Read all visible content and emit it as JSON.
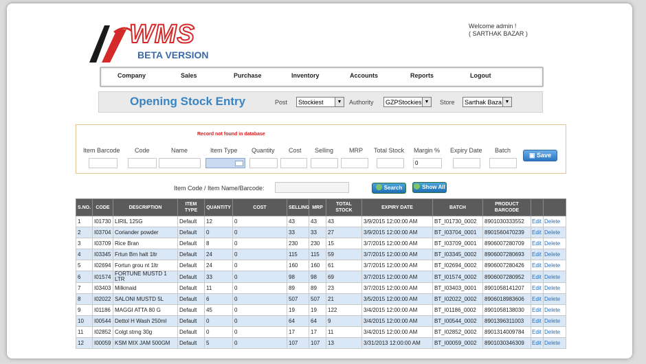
{
  "header": {
    "logo_text": "WMS",
    "logo_subtitle": "BETA VERSION",
    "welcome": "Welcome admin !",
    "store_line": "( SARTHAK BAZAR )"
  },
  "menu": [
    "Company",
    "Sales",
    "Purchase",
    "Inventory",
    "Accounts",
    "Reports",
    "Logout"
  ],
  "titlebar": {
    "title": "Opening Stock Entry",
    "post_label": "Post",
    "post_value": "Stockiest",
    "authority_label": "Authority",
    "authority_value": "GZPStockies",
    "store_label": "Store",
    "store_value": "Sarthak Baza"
  },
  "form": {
    "error": "Record not found in database",
    "labels": [
      "Item Barcode",
      "Code",
      "Name",
      "Item Type",
      "Quantity",
      "Cost",
      "Selling",
      "MRP",
      "Total Stock",
      "Margin %",
      "Expiry Date",
      "Batch"
    ],
    "margin_value": "0",
    "save_label": "Save"
  },
  "search": {
    "label": "Item Code / Item Name/Barcode:",
    "search_label": "Search",
    "showall_label": "Show All"
  },
  "table": {
    "headers": [
      "S.NO.",
      "CODE",
      "DESCRIPTION",
      "ITEM TYPE",
      "QUANTITY",
      "COST",
      "SELLING",
      "MRP",
      "TOTAL STOCK",
      "EXPIRY DATE",
      "BATCH",
      "PRODUCT BARCODE",
      "",
      ""
    ],
    "edit_label": "Edit",
    "delete_label": "Delete",
    "rows": [
      [
        "1",
        "I01730",
        "LIRIL 125G",
        "Default",
        "12",
        "0",
        "43",
        "43",
        "43",
        "3/9/2015 12:00:00 AM",
        "BT_I01730_0002",
        "8901030333552"
      ],
      [
        "2",
        "I03704",
        "Coriander powder",
        "Default",
        "0",
        "0",
        "33",
        "33",
        "27",
        "3/9/2015 12:00:00 AM",
        "BT_I03704_0001",
        "8901560470239"
      ],
      [
        "3",
        "I03709",
        "Rice Bran",
        "Default",
        "8",
        "0",
        "230",
        "230",
        "15",
        "3/7/2015 12:00:00 AM",
        "BT_I03709_0001",
        "8906007280709"
      ],
      [
        "4",
        "I03345",
        "Frtun Brn halt 1ltr",
        "Default",
        "24",
        "0",
        "115",
        "115",
        "59",
        "3/7/2015 12:00:00 AM",
        "BT_I03345_0002",
        "8906007280693"
      ],
      [
        "5",
        "I02694",
        "Fortun grou nt 1ltr",
        "Default",
        "24",
        "0",
        "160",
        "160",
        "61",
        "3/7/2015 12:00:00 AM",
        "BT_I02694_0002",
        "8906007280426"
      ],
      [
        "6",
        "I01574",
        "FORTUNE MUSTD 1 LTR",
        "Default",
        "33",
        "0",
        "98",
        "98",
        "69",
        "3/7/2015 12:00:00 AM",
        "BT_I01574_0002",
        "8906007280952"
      ],
      [
        "7",
        "I03403",
        "Milkmaid",
        "Default",
        "11",
        "0",
        "89",
        "89",
        "23",
        "3/7/2015 12:00:00 AM",
        "BT_I03403_0001",
        "8901058141207"
      ],
      [
        "8",
        "I02022",
        "SALONI MUSTD 5L",
        "Default",
        "6",
        "0",
        "507",
        "507",
        "21",
        "3/5/2015 12:00:00 AM",
        "BT_I02022_0002",
        "8906018983606"
      ],
      [
        "9",
        "I01186",
        "MAGGI ATTA 80 G",
        "Default",
        "45",
        "0",
        "19",
        "19",
        "122",
        "3/4/2015 12:00:00 AM",
        "BT_I01186_0002",
        "8901058138030"
      ],
      [
        "10",
        "I00544",
        "Dettol H Wash 250ml",
        "Default",
        "0",
        "0",
        "64",
        "64",
        "9",
        "3/4/2015 12:00:00 AM",
        "BT_I00544_0002",
        "8901396311003"
      ],
      [
        "11",
        "I02852",
        "Colgt strng 30g",
        "Default",
        "0",
        "0",
        "17",
        "17",
        "11",
        "3/4/2015 12:00:00 AM",
        "BT_I02852_0002",
        "8901314009784"
      ],
      [
        "12",
        "I00059",
        "KSM MIX JAM 500GM",
        "Default",
        "5",
        "0",
        "107",
        "107",
        "13",
        "3/31/2013 12:00:00 AM",
        "BT_I00059_0002",
        "8901030346309"
      ]
    ]
  },
  "colors": {
    "title": "#3a84c2",
    "error": "#d21b1b",
    "header_bg": "#5b5b5b",
    "row_alt": "#d9e7f7",
    "link": "#2a6eb8"
  }
}
